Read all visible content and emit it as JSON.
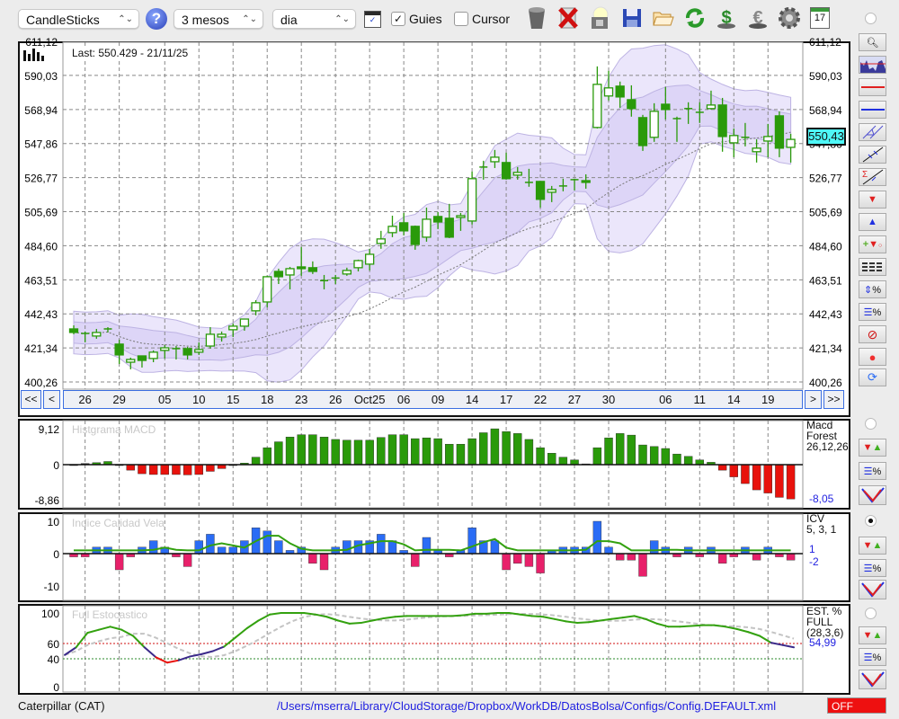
{
  "toolbar": {
    "chart_type": "CandleSticks",
    "period": "3 mesos",
    "interval": "dia",
    "guides_label": "Guies",
    "guides_checked": true,
    "cursor_label": "Cursor",
    "cursor_checked": false,
    "calendar_day": "17",
    "check_mark": "✓"
  },
  "main_chart": {
    "last_label": "Last: 550.429 - 21/11/25",
    "price_ticks": [
      "611,12",
      "590,03",
      "568,94",
      "547,86",
      "526,77",
      "505,69",
      "484,60",
      "463,51",
      "442,43",
      "421,34",
      "400,26"
    ],
    "price_tick_values": [
      611.12,
      590.03,
      568.94,
      547.86,
      526.77,
      505.69,
      484.6,
      463.51,
      442.43,
      421.34,
      400.26
    ],
    "current_price_label": "550,43",
    "nav": {
      "first": "<<",
      "prev": "<",
      "next": ">",
      "last": ">>"
    },
    "date_labels": [
      {
        "i": 1,
        "t": "26"
      },
      {
        "i": 4,
        "t": "29"
      },
      {
        "i": 8,
        "t": "05"
      },
      {
        "i": 11,
        "t": "10"
      },
      {
        "i": 14,
        "t": "15"
      },
      {
        "i": 17,
        "t": "18"
      },
      {
        "i": 20,
        "t": "23"
      },
      {
        "i": 23,
        "t": "26"
      },
      {
        "i": 26,
        "t": "Oct25"
      },
      {
        "i": 29,
        "t": "06"
      },
      {
        "i": 32,
        "t": "09"
      },
      {
        "i": 35,
        "t": "14"
      },
      {
        "i": 38,
        "t": "17"
      },
      {
        "i": 41,
        "t": "22"
      },
      {
        "i": 44,
        "t": "27"
      },
      {
        "i": 47,
        "t": "30"
      },
      {
        "i": 52,
        "t": "06"
      },
      {
        "i": 55,
        "t": "11"
      },
      {
        "i": 58,
        "t": "14"
      },
      {
        "i": 61,
        "t": "19"
      }
    ]
  },
  "chart_data": [
    {
      "type": "candlestick",
      "title": "Caterpillar (CAT)",
      "ylim": [
        400.26,
        611.12
      ],
      "ohlc": [
        [
          433.1,
          435.3,
          429.8,
          430.9
        ],
        [
          430.3,
          431.5,
          424.8,
          429.8
        ],
        [
          428.7,
          433.1,
          427.0,
          430.9
        ],
        [
          432.6,
          434.2,
          430.9,
          433.1
        ],
        [
          423.7,
          426.4,
          411.4,
          417.0
        ],
        [
          412.5,
          415.3,
          408.1,
          414.2
        ],
        [
          416.4,
          416.4,
          409.2,
          413.6
        ],
        [
          414.8,
          419.8,
          412.5,
          418.7
        ],
        [
          419.8,
          423.1,
          414.8,
          421.4
        ],
        [
          420.9,
          422.5,
          414.2,
          420.3
        ],
        [
          420.9,
          422.0,
          414.2,
          417.0
        ],
        [
          418.7,
          424.8,
          417.0,
          420.3
        ],
        [
          422.5,
          434.2,
          420.9,
          429.8
        ],
        [
          428.1,
          431.5,
          425.3,
          429.8
        ],
        [
          432.6,
          436.5,
          428.1,
          434.8
        ],
        [
          434.8,
          439.2,
          432.0,
          439.2
        ],
        [
          444.3,
          450.9,
          441.5,
          449.3
        ],
        [
          449.8,
          466.0,
          446.5,
          465.4
        ],
        [
          468.7,
          470.4,
          460.9,
          465.4
        ],
        [
          466.5,
          471.5,
          457.6,
          470.4
        ],
        [
          471.5,
          483.8,
          466.0,
          470.4
        ],
        [
          471.0,
          474.9,
          467.1,
          468.7
        ],
        [
          463.0,
          466.5,
          457.6,
          462.6
        ],
        [
          464.3,
          466.5,
          460.9,
          464.6
        ],
        [
          467.1,
          471.0,
          466.0,
          469.3
        ],
        [
          471.0,
          476.0,
          468.7,
          475.4
        ],
        [
          473.2,
          482.7,
          469.3,
          479.3
        ],
        [
          486.0,
          493.8,
          482.7,
          488.8
        ],
        [
          492.7,
          503.2,
          489.9,
          496.6
        ],
        [
          498.8,
          504.9,
          491.0,
          493.8
        ],
        [
          496.6,
          497.1,
          482.1,
          485.4
        ],
        [
          489.9,
          508.2,
          487.1,
          501.0
        ],
        [
          502.7,
          505.5,
          494.9,
          499.3
        ],
        [
          501.6,
          510.5,
          489.3,
          489.9
        ],
        [
          502.1,
          504.9,
          493.8,
          503.2
        ],
        [
          499.9,
          530.5,
          497.7,
          526.1
        ],
        [
          533.0,
          537.2,
          525.5,
          533.3
        ],
        [
          536.6,
          543.9,
          532.7,
          539.4
        ],
        [
          536.1,
          542.2,
          525.5,
          526.1
        ],
        [
          528.3,
          533.3,
          525.5,
          530.0
        ],
        [
          523.6,
          532.2,
          521.1,
          523.8
        ],
        [
          524.4,
          524.4,
          508.2,
          513.3
        ],
        [
          517.7,
          521.6,
          511.6,
          519.4
        ],
        [
          521.4,
          526.1,
          518.3,
          521.6
        ],
        [
          525.3,
          526.1,
          518.8,
          525.5
        ],
        [
          524.9,
          528.8,
          519.9,
          523.8
        ],
        [
          557.8,
          595.6,
          557.2,
          584.5
        ],
        [
          577.3,
          592.8,
          574.5,
          582.3
        ],
        [
          583.4,
          586.2,
          570.0,
          576.7
        ],
        [
          575.0,
          583.9,
          564.5,
          569.5
        ],
        [
          563.9,
          565.6,
          543.3,
          546.6
        ],
        [
          551.7,
          572.8,
          548.9,
          567.8
        ],
        [
          572.2,
          582.8,
          562.8,
          568.9
        ],
        [
          563.3,
          564.5,
          548.9,
          563.3
        ],
        [
          569.5,
          573.4,
          560.0,
          569.5
        ],
        [
          567.2,
          573.4,
          560.6,
          567.2
        ],
        [
          569.5,
          580.6,
          568.9,
          571.7
        ],
        [
          571.7,
          576.1,
          542.8,
          552.2
        ],
        [
          548.3,
          557.2,
          539.4,
          552.8
        ],
        [
          551.7,
          560.6,
          546.1,
          551.7
        ],
        [
          542.8,
          550.5,
          536.1,
          545.0
        ],
        [
          549.4,
          560.0,
          539.4,
          552.2
        ],
        [
          565.0,
          567.8,
          539.4,
          545.0
        ],
        [
          545.5,
          553.9,
          536.1,
          550.43
        ]
      ]
    },
    {
      "type": "bar",
      "title": "Histgrama MACD",
      "ylim": [
        -8.86,
        9.12
      ],
      "tick_labels": [
        "9,12",
        "0",
        "-8,86"
      ],
      "tick_values": [
        9.12,
        0,
        -8.86
      ],
      "legend": [
        "Macd",
        "Forest",
        "26,12,26"
      ],
      "last_value_label": "-8,05",
      "values": [
        0,
        0.3,
        0.5,
        0.8,
        -0.2,
        -1.4,
        -2.3,
        -2.5,
        -2.5,
        -2.5,
        -2.6,
        -2.5,
        -1.7,
        -1.0,
        -0.2,
        0.4,
        1.9,
        4.3,
        5.8,
        7.0,
        7.6,
        7.6,
        7.0,
        6.4,
        6.2,
        6.2,
        6.2,
        6.9,
        7.6,
        7.6,
        6.6,
        6.8,
        6.6,
        5.2,
        5.2,
        6.6,
        8.1,
        9.1,
        8.4,
        7.9,
        6.4,
        4.3,
        2.9,
        1.9,
        1.2,
        0.2,
        4.3,
        6.8,
        7.9,
        7.5,
        5.0,
        4.6,
        4.1,
        2.7,
        2.1,
        1.2,
        0.6,
        -1.4,
        -3.1,
        -4.8,
        -6.4,
        -7.2,
        -8.3,
        -8.7
      ]
    },
    {
      "type": "bar",
      "title": "Indice Calidad Vela",
      "ylim": [
        -10,
        10
      ],
      "tick_labels": [
        "10",
        "0",
        "-10"
      ],
      "tick_values": [
        10,
        0,
        -10
      ],
      "legend": [
        "ICV",
        "5, 3, 1"
      ],
      "value_labels": [
        "1",
        "-2"
      ],
      "values": [
        -1,
        -1,
        2,
        2,
        -5,
        -1,
        2,
        4,
        2,
        -1,
        -4,
        4,
        6,
        2,
        2,
        4,
        8,
        7,
        4,
        1,
        2,
        -3,
        -5,
        2,
        4,
        4,
        4,
        6,
        4,
        1,
        -4,
        5,
        1,
        -1,
        1,
        8,
        4,
        4,
        -5,
        -3,
        -4,
        -6,
        1,
        2,
        2,
        2,
        10,
        2,
        -2,
        -2,
        -7,
        4,
        2,
        -1,
        2,
        -1,
        2,
        -3,
        -1,
        2,
        -2,
        2,
        -1,
        -2
      ]
    },
    {
      "type": "line",
      "title": "Full Estocastico",
      "ylim": [
        0,
        100
      ],
      "tick_labels": [
        "100",
        "60",
        "40",
        "0"
      ],
      "tick_values": [
        100,
        60,
        40,
        0
      ],
      "levels": [
        60,
        40
      ],
      "legend": [
        "EST. %",
        "FULL",
        "(28,3,6)"
      ],
      "last_value_label": "54,99",
      "k_values": [
        45,
        55,
        74,
        78,
        82,
        78,
        70,
        55,
        42,
        35,
        38,
        43,
        46,
        50,
        56,
        68,
        80,
        90,
        98,
        100,
        100,
        100,
        98,
        95,
        90,
        86,
        87,
        90,
        93,
        95,
        96,
        96,
        96,
        96,
        96,
        97,
        99,
        99,
        100,
        100,
        98,
        96,
        95,
        92,
        89,
        87,
        88,
        90,
        92,
        94,
        96,
        92,
        86,
        82,
        82,
        83,
        84,
        84,
        82,
        79,
        75,
        70,
        61,
        58,
        54.99
      ]
    }
  ],
  "status": {
    "instrument": "Caterpillar (CAT)",
    "config_path": "/Users/mserra/Library/CloudStorage/Dropbox/WorkDB/DatosBolsa/Configs/Config.DEFAULT.xml",
    "connection": "OFF"
  },
  "colors": {
    "candle": "#2a9a0a",
    "macd_pos": "#2a9a0a",
    "macd_neg": "#e8120c",
    "icv_pos": "#2a6cf5",
    "icv_neg": "#e8206a",
    "icv_line": "#33a10f",
    "band_outer": "#ebe6fb",
    "band_inner": "#ddd5f7",
    "band_stroke": "#bdb3e3",
    "stoch_high": "#33a10f",
    "stoch_mid": "#3b2a8a",
    "stoch_low": "#e8120c",
    "accent_blue": "#1f1fe0",
    "highlight": "#4ef7f7",
    "off_red": "#ee1010"
  }
}
